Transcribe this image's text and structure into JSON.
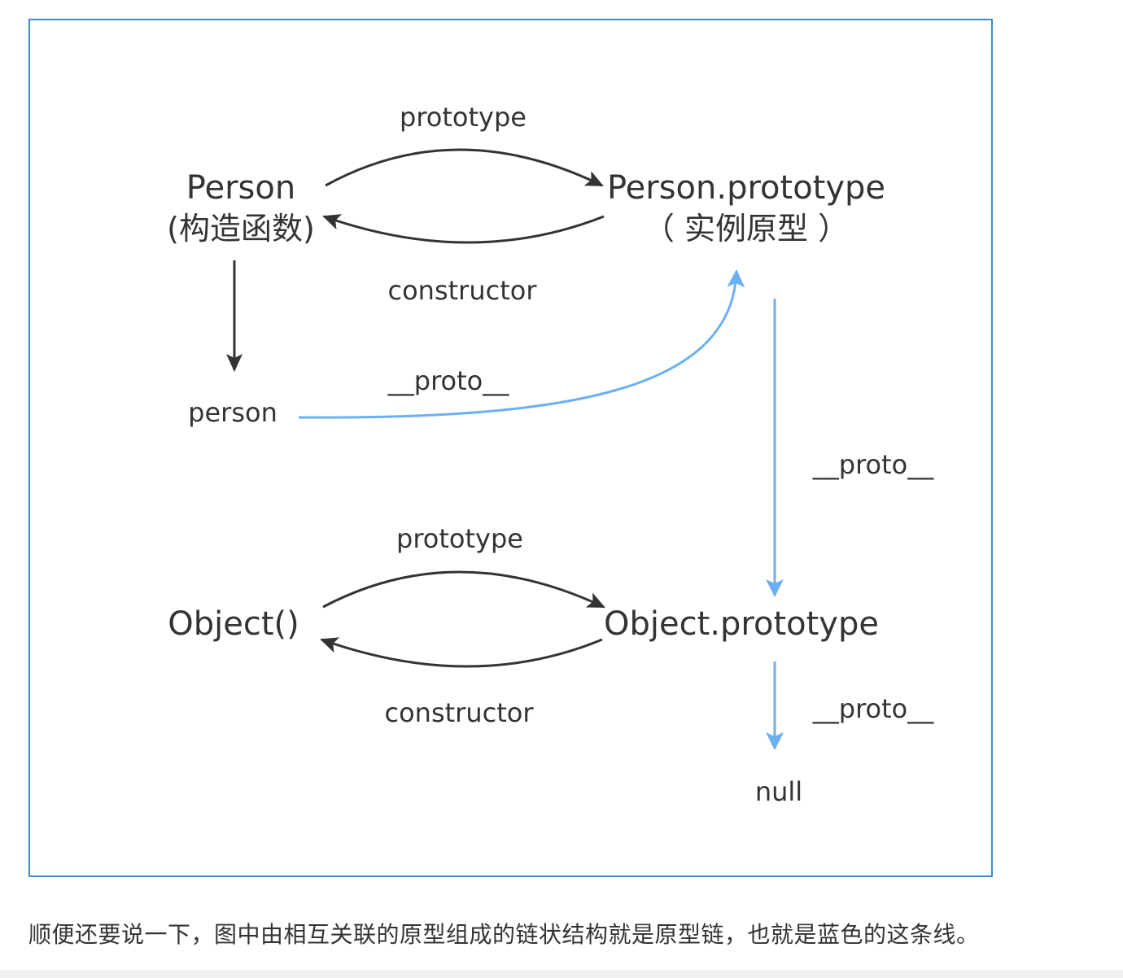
{
  "nodes": {
    "person_ctor": "Person",
    "person_ctor_sub": "(构造函数)",
    "person_proto": "Person.prototype",
    "person_proto_sub": "（ 实例原型 ）",
    "person_instance": "person",
    "object_ctor": "Object()",
    "object_proto": "Object.prototype",
    "null_node": "null"
  },
  "edges": {
    "prototype_top": "prototype",
    "constructor_top": "constructor",
    "proto_person": "__proto__",
    "proto_person_proto": "__proto__",
    "prototype_bottom": "prototype",
    "constructor_bottom": "constructor",
    "proto_object_proto": "__proto__"
  },
  "caption": "顺便还要说一下，图中由相互关联的原型组成的链状结构就是原型链，也就是蓝色的这条线。",
  "colors": {
    "frame": "#3d8bd1",
    "black_arrow": "#333333",
    "blue_arrow": "#6ab0f3"
  }
}
